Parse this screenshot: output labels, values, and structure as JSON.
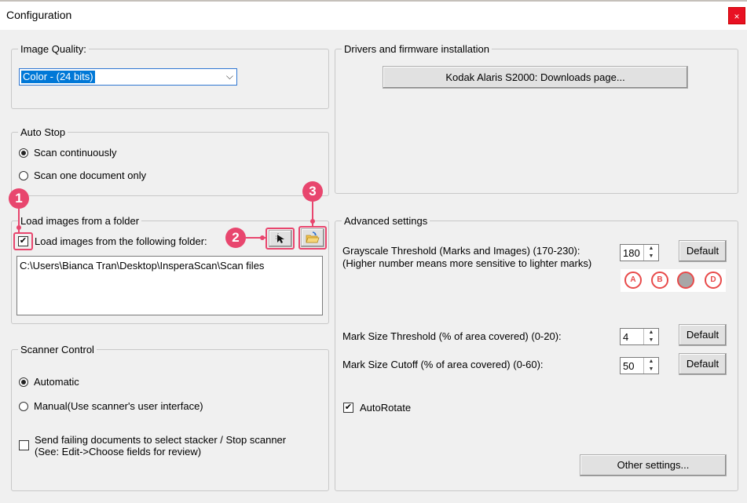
{
  "window": {
    "title": "Configuration",
    "close_glyph": "×"
  },
  "image_quality": {
    "legend": "Image Quality:",
    "selected": "Color -  (24 bits)"
  },
  "auto_stop": {
    "legend": "Auto Stop",
    "options": [
      {
        "label": "Scan continuously",
        "selected": true
      },
      {
        "label": "Scan one document only",
        "selected": false
      }
    ]
  },
  "load_folder": {
    "legend": "Load images from a folder",
    "checkbox_label": "Load images from the following folder:",
    "checked": true,
    "path": "C:\\Users\\Bianca Tran\\Desktop\\InsperaScan\\Scan files"
  },
  "scanner_control": {
    "legend": "Scanner Control",
    "options": [
      {
        "label": "Automatic",
        "selected": true
      },
      {
        "label": "Manual(Use scanner's user interface)",
        "selected": false
      }
    ],
    "send_failing_line1": "Send failing documents to select stacker / Stop scanner",
    "send_failing_line2": "(See: Edit->Choose fields for review)"
  },
  "drivers": {
    "legend": "Drivers and firmware installation",
    "button": "Kodak Alaris S2000: Downloads page..."
  },
  "advanced": {
    "legend": "Advanced settings",
    "grayscale_line1": "Grayscale Threshold (Marks and Images) (170-230):",
    "grayscale_line2": "(Higher number means more sensitive to lighter marks)",
    "grayscale_value": "180",
    "mark_size_label": "Mark Size Threshold (% of area covered) (0-20):",
    "mark_size_value": "4",
    "mark_cutoff_label": "Mark Size Cutoff (% of area covered) (0-60):",
    "mark_cutoff_value": "50",
    "default_label": "Default",
    "autorotate_label": "AutoRotate",
    "autorotate_checked": true,
    "other_settings": "Other settings...",
    "bubbles": [
      "A",
      "B",
      "",
      "D"
    ]
  },
  "annotations": {
    "one": "1",
    "two": "2",
    "three": "3"
  },
  "icons": {
    "pick": "cursor-select-icon",
    "folder": "open-folder-icon",
    "check": "✔",
    "spin_up": "▲",
    "spin_down": "▼",
    "chevron": "⌵"
  },
  "colors": {
    "accent": "#0078d7",
    "annotation": "#e8466e"
  }
}
